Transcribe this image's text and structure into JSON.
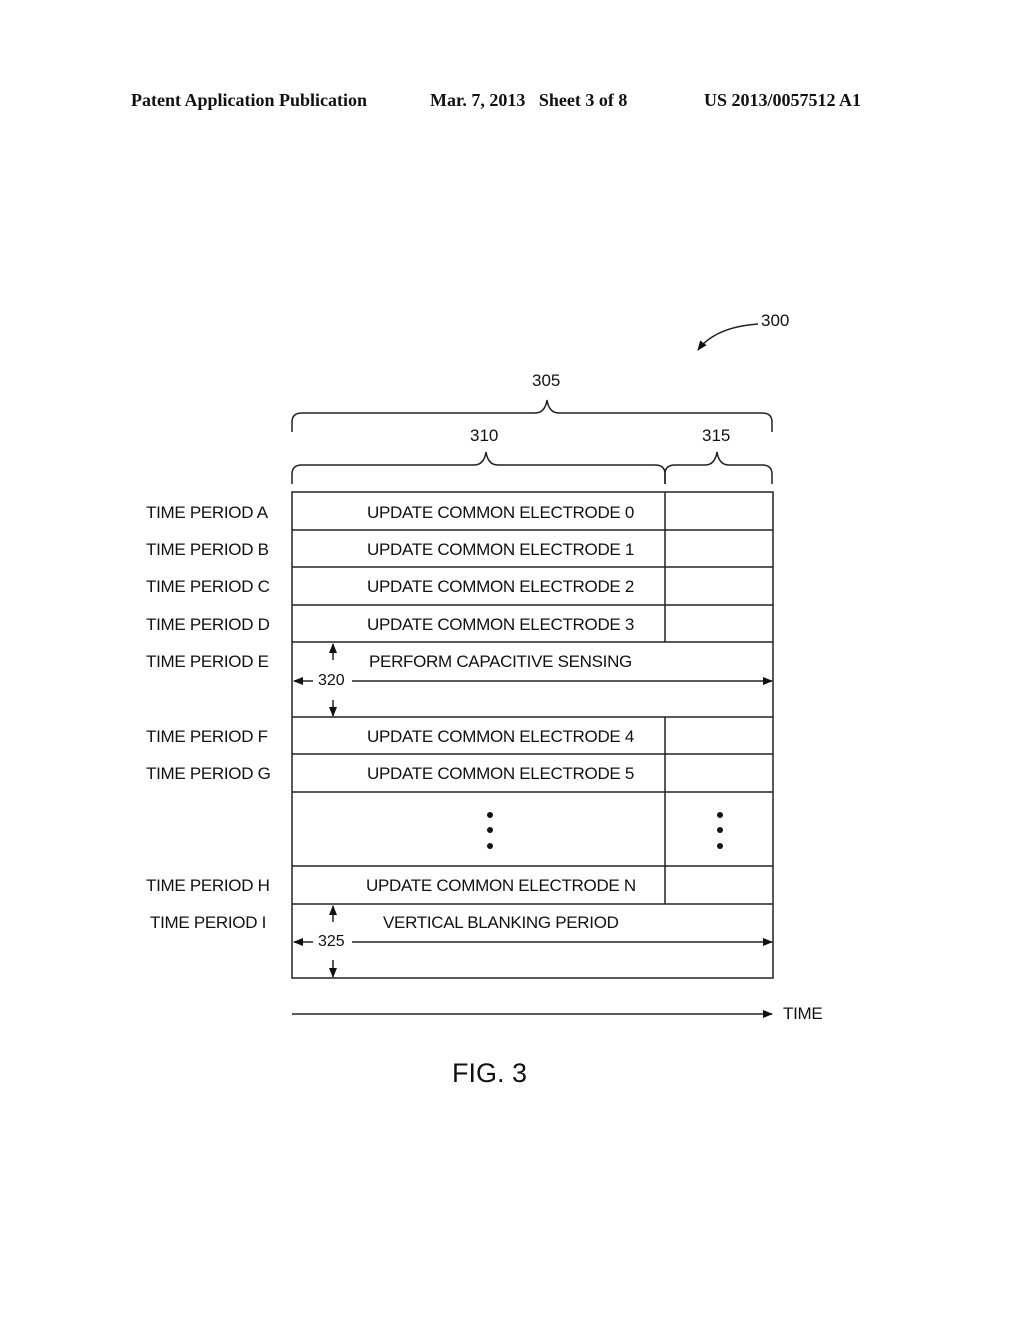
{
  "header": {
    "publication": "Patent Application Publication",
    "date_sheet": "Mar. 7, 2013   Sheet 3 of 8",
    "number": "US 2013/0057512 A1"
  },
  "figure": {
    "ref_main": "300",
    "ref_total": "305",
    "ref_update": "310",
    "ref_other": "315",
    "ref_sensing_width": "320",
    "ref_blanking_width": "325",
    "time_axis_label": "TIME",
    "caption": "FIG. 3"
  },
  "rows": [
    {
      "period": "TIME PERIOD A",
      "content": "UPDATE COMMON ELECTRODE 0"
    },
    {
      "period": "TIME PERIOD B",
      "content": "UPDATE COMMON ELECTRODE 1"
    },
    {
      "period": "TIME PERIOD C",
      "content": "UPDATE COMMON ELECTRODE 2"
    },
    {
      "period": "TIME PERIOD D",
      "content": "UPDATE COMMON ELECTRODE 3"
    },
    {
      "period": "TIME PERIOD E",
      "content": "PERFORM CAPACITIVE SENSING"
    },
    {
      "period": "TIME PERIOD F",
      "content": "UPDATE COMMON ELECTRODE 4"
    },
    {
      "period": "TIME PERIOD G",
      "content": "UPDATE COMMON ELECTRODE 5"
    },
    {
      "period": "TIME PERIOD H",
      "content": "UPDATE COMMON ELECTRODE N"
    },
    {
      "period": "TIME PERIOD I",
      "content": "VERTICAL BLANKING PERIOD"
    }
  ]
}
